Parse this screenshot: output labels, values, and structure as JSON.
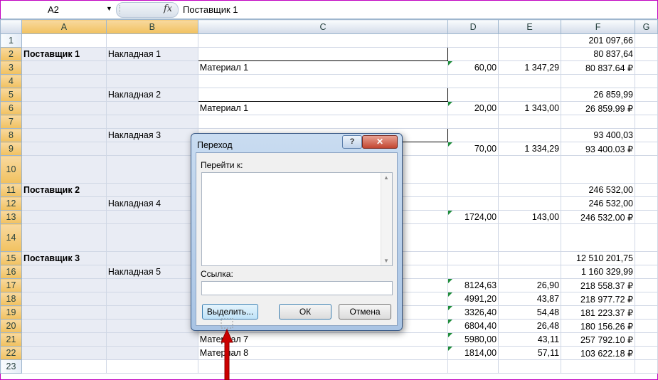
{
  "formula_bar": {
    "name_box": "A2",
    "fx": "fx",
    "content": "Поставщик 1"
  },
  "columns": [
    "",
    "A",
    "B",
    "C",
    "D",
    "E",
    "F",
    "G"
  ],
  "rows": [
    {
      "n": "1",
      "a": "",
      "b": "",
      "c": "",
      "d": "",
      "e": "",
      "f": "201 097,66"
    },
    {
      "n": "2",
      "a": "Поставщик 1",
      "b": "Накладная 1",
      "c": "",
      "d": "",
      "e": "",
      "f": "80 837,64"
    },
    {
      "n": "3",
      "a": "",
      "b": "",
      "c": "Материал 1",
      "d": "60,00",
      "e": "1 347,29",
      "f": "80 837.64 ₽"
    },
    {
      "n": "4",
      "a": "",
      "b": "",
      "c": "",
      "d": "",
      "e": "",
      "f": ""
    },
    {
      "n": "5",
      "a": "",
      "b": "Накладная 2",
      "c": "",
      "d": "",
      "e": "",
      "f": "26 859,99"
    },
    {
      "n": "6",
      "a": "",
      "b": "",
      "c": "Материал 1",
      "d": "20,00",
      "e": "1 343,00",
      "f": "26 859.99 ₽"
    },
    {
      "n": "7",
      "a": "",
      "b": "",
      "c": "",
      "d": "",
      "e": "",
      "f": ""
    },
    {
      "n": "8",
      "a": "",
      "b": "Накладная 3",
      "c": "",
      "d": "",
      "e": "",
      "f": "93 400,03"
    },
    {
      "n": "9",
      "a": "",
      "b": "",
      "c": "",
      "d": "70,00",
      "e": "1 334,29",
      "f": "93 400.03 ₽"
    },
    {
      "n": "10",
      "a": "",
      "b": "",
      "c": "",
      "d": "",
      "e": "",
      "f": ""
    },
    {
      "n": "11",
      "a": "Поставщик 2",
      "b": "",
      "c": "",
      "d": "",
      "e": "",
      "f": "246 532,00"
    },
    {
      "n": "12",
      "a": "",
      "b": "Накладная 4",
      "c": "",
      "d": "",
      "e": "",
      "f": "246 532,00"
    },
    {
      "n": "13",
      "a": "",
      "b": "",
      "c": "",
      "d": "1724,00",
      "e": "143,00",
      "f": "246 532.00 ₽"
    },
    {
      "n": "14",
      "a": "",
      "b": "",
      "c": "",
      "d": "",
      "e": "",
      "f": ""
    },
    {
      "n": "15",
      "a": "Поставщик 3",
      "b": "",
      "c": "",
      "d": "",
      "e": "",
      "f": "12 510 201,75"
    },
    {
      "n": "16",
      "a": "",
      "b": "Накладная 5",
      "c": "",
      "d": "",
      "e": "",
      "f": "1 160 329,99"
    },
    {
      "n": "17",
      "a": "",
      "b": "",
      "c": "",
      "d": "8124,63",
      "e": "26,90",
      "f": "218 558.37 ₽"
    },
    {
      "n": "18",
      "a": "",
      "b": "",
      "c": "",
      "d": "4991,20",
      "e": "43,87",
      "f": "218 977.72 ₽"
    },
    {
      "n": "19",
      "a": "",
      "b": "",
      "c": "",
      "d": "3326,40",
      "e": "54,48",
      "f": "181 223.37 ₽"
    },
    {
      "n": "20",
      "a": "",
      "b": "",
      "c": "",
      "d": "6804,40",
      "e": "26,48",
      "f": "180 156.26 ₽"
    },
    {
      "n": "21",
      "a": "",
      "b": "",
      "c": "Материал 7",
      "d": "5980,00",
      "e": "43,11",
      "f": "257 792.10 ₽"
    },
    {
      "n": "22",
      "a": "",
      "b": "",
      "c": "Материал 8",
      "d": "1814,00",
      "e": "57,11",
      "f": "103 622.18 ₽"
    },
    {
      "n": "23",
      "a": "",
      "b": "",
      "c": "",
      "d": "",
      "e": "",
      "f": ""
    }
  ],
  "dialog": {
    "title": "Переход",
    "help": "?",
    "close": "✕",
    "goto_label": "Перейти к:",
    "ref_label": "Ссылка:",
    "ref_value": "",
    "btn_select": "Выделить...",
    "btn_ok": "ОК",
    "btn_cancel": "Отмена"
  },
  "colors": {
    "arrow": "#cc0000",
    "selected_header": "#f1c15f",
    "selection_fill": "#e9ecf4"
  }
}
